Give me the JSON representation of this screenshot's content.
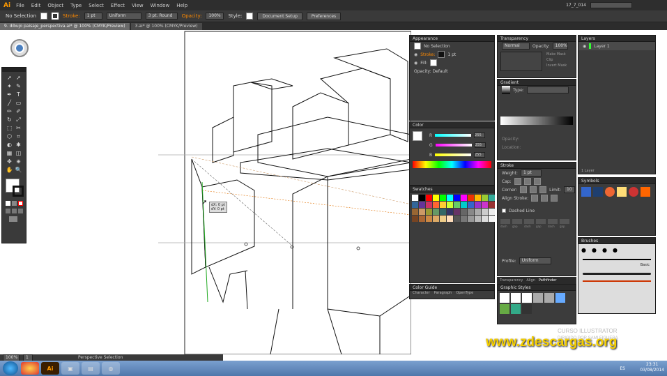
{
  "menubar": {
    "logo": "Ai",
    "items": [
      "File",
      "Edit",
      "Object",
      "Type",
      "Select",
      "Effect",
      "View",
      "Window",
      "Help"
    ],
    "doc_id": "17_7_014",
    "search_placeholder": ""
  },
  "control": {
    "selection_label": "No Selection",
    "stroke_label": "Stroke:",
    "stroke_value": "1 pt",
    "brush": "Uniform",
    "style_label": "3 pt. Round",
    "opacity_label": "Opacity:",
    "opacity_value": "100%",
    "style2_label": "Style:",
    "doc_setup": "Document Setup",
    "preferences": "Preferences"
  },
  "tabs": [
    "9. dibujo paisaje_perspectiva.ai* @ 100% (CMYK/Preview)",
    "3.ai* @ 100% (CMYK/Preview)"
  ],
  "tooltip": {
    "dx": "dX: 0 pt",
    "dy": "dY: 0 pt"
  },
  "appearance": {
    "title": "Appearance",
    "selection": "No Selection",
    "stroke": "Stroke:",
    "stroke_weight": "1 pt",
    "fill": "Fill:",
    "opacity": "Opacity: Default"
  },
  "transparency": {
    "title": "Transparency",
    "mode": "Normal",
    "opacity_label": "Opacity:",
    "opacity": "100%",
    "make_mask": "Make Mask",
    "clip": "Clip",
    "invert": "Invert Mask"
  },
  "layers": {
    "title": "Layers",
    "layer_name": "Layer 1",
    "footer": "1 Layer"
  },
  "gradient": {
    "title": "Gradient",
    "type_label": "Type:",
    "location": "Location:",
    "opacity": "Opacity:"
  },
  "color": {
    "title": "Color",
    "labels": [
      "R",
      "G",
      "B"
    ],
    "values": [
      "255",
      "255",
      "255"
    ]
  },
  "stroke": {
    "title": "Stroke",
    "weight_label": "Weight:",
    "weight": "1 pt",
    "cap": "Cap:",
    "corner": "Corner:",
    "limit": "Limit:",
    "limit_value": "10",
    "align": "Align Stroke:",
    "dashed": "Dashed Line",
    "dash_labels": [
      "dash",
      "gap",
      "dash",
      "gap",
      "dash",
      "gap"
    ],
    "profile": "Profile:",
    "profile_value": "Uniform"
  },
  "swatches": {
    "title": "Swatches"
  },
  "symbols": {
    "title": "Symbols"
  },
  "brushes": {
    "title": "Brushes",
    "basic": "Basic"
  },
  "graphic_styles": {
    "title": "Graphic Styles"
  },
  "lower_tabs": [
    "Transparency",
    "Align",
    "Pathfinder"
  ],
  "color_guide": {
    "title": "Color Guide",
    "tabs": [
      "Character",
      "Paragraph",
      "OpenType"
    ]
  },
  "status": {
    "zoom": "100%",
    "page": "1",
    "tool": "Perspective Selection"
  },
  "watermark": "www.zdescargas.org",
  "watermark_sub": [
    "CURSO ILLUSTRATOR",
    "DIRIGIDO POR SAMI FIGUERA"
  ],
  "clock": {
    "lang": "ES",
    "time": "23:31",
    "date": "03/08/2014"
  },
  "colors": {
    "accent": "#ff8a00",
    "panel": "#3c3c3c",
    "watermark": "#f6d000"
  }
}
